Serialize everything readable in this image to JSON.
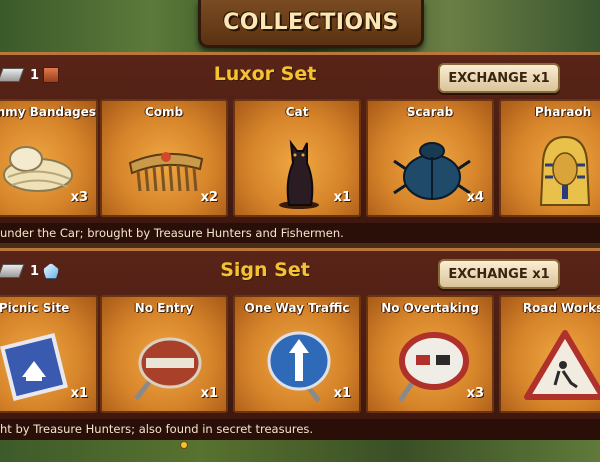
{
  "header": {
    "title": "COLLECTIONS"
  },
  "sets": [
    {
      "reward_count": "1",
      "reward_icon_1": "metal-bar-icon",
      "reward_icon_2": "brick-icon",
      "title": "Luxor Set",
      "exchange_label": "EXCHANGE x1",
      "items": [
        {
          "name": "Mummy Bandages",
          "count": "x3",
          "icon": "bandages-icon"
        },
        {
          "name": "Comb",
          "count": "x2",
          "icon": "comb-icon"
        },
        {
          "name": "Cat",
          "count": "x1",
          "icon": "cat-statue-icon"
        },
        {
          "name": "Scarab",
          "count": "x4",
          "icon": "scarab-icon"
        },
        {
          "name": "Pharaoh",
          "count": "",
          "icon": "pharaoh-mask-icon"
        }
      ],
      "info": "under the Car; brought by Treasure Hunters and Fishermen."
    },
    {
      "reward_count": "1",
      "reward_icon_1": "metal-bar-icon",
      "reward_icon_2": "crystal-icon",
      "title": "Sign Set",
      "exchange_label": "EXCHANGE x1",
      "items": [
        {
          "name": "Picnic Site",
          "count": "x1",
          "icon": "picnic-sign-icon"
        },
        {
          "name": "No Entry",
          "count": "x1",
          "icon": "no-entry-sign-icon"
        },
        {
          "name": "One Way Traffic",
          "count": "x1",
          "icon": "one-way-sign-icon"
        },
        {
          "name": "No Overtaking",
          "count": "x3",
          "icon": "no-overtaking-sign-icon"
        },
        {
          "name": "Road Works",
          "count": "",
          "icon": "road-works-sign-icon"
        }
      ],
      "info": "ht by Treasure Hunters; also found in secret treasures."
    }
  ],
  "colors": {
    "title_gold": "#f5c232",
    "panel": "#4a1c12",
    "card": "#d6842a"
  }
}
